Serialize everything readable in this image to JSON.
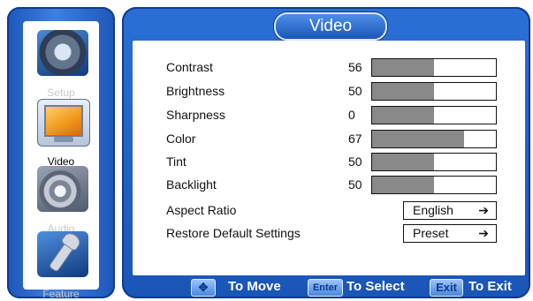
{
  "sidebar": {
    "items": [
      {
        "label": "Setup",
        "icon": "gear-icon",
        "active": false
      },
      {
        "label": "Video",
        "icon": "monitor-icon",
        "active": true
      },
      {
        "label": "Audio",
        "icon": "speaker-icon",
        "active": false
      },
      {
        "label": "Feature",
        "icon": "wrench-icon",
        "active": false
      }
    ]
  },
  "panel": {
    "title": "Video"
  },
  "settings": [
    {
      "label": "Contrast",
      "value": "56",
      "fill_percent": 50
    },
    {
      "label": "Brightness",
      "value": "50",
      "fill_percent": 50
    },
    {
      "label": "Sharpness",
      "value": "0",
      "fill_percent": 50
    },
    {
      "label": "Color",
      "value": "67",
      "fill_percent": 74
    },
    {
      "label": "Tint",
      "value": "50",
      "fill_percent": 50
    },
    {
      "label": "Backlight",
      "value": "50",
      "fill_percent": 50
    }
  ],
  "options": [
    {
      "label": "Aspect Ratio",
      "value": "English",
      "icon": "arrow-right-icon"
    },
    {
      "label": "Restore Default Settings",
      "value": "Preset",
      "icon": "arrow-right-icon"
    }
  ],
  "footer": {
    "move_key": "✥",
    "move_text": "To Move",
    "enter_key": "Enter",
    "enter_text": "To Select",
    "exit_key": "Exit",
    "exit_text": "To Exit"
  },
  "colors": {
    "accent_blue": "#1a55b6",
    "bar_fill": "#898989",
    "inactive_label": "#c7c7c7"
  }
}
